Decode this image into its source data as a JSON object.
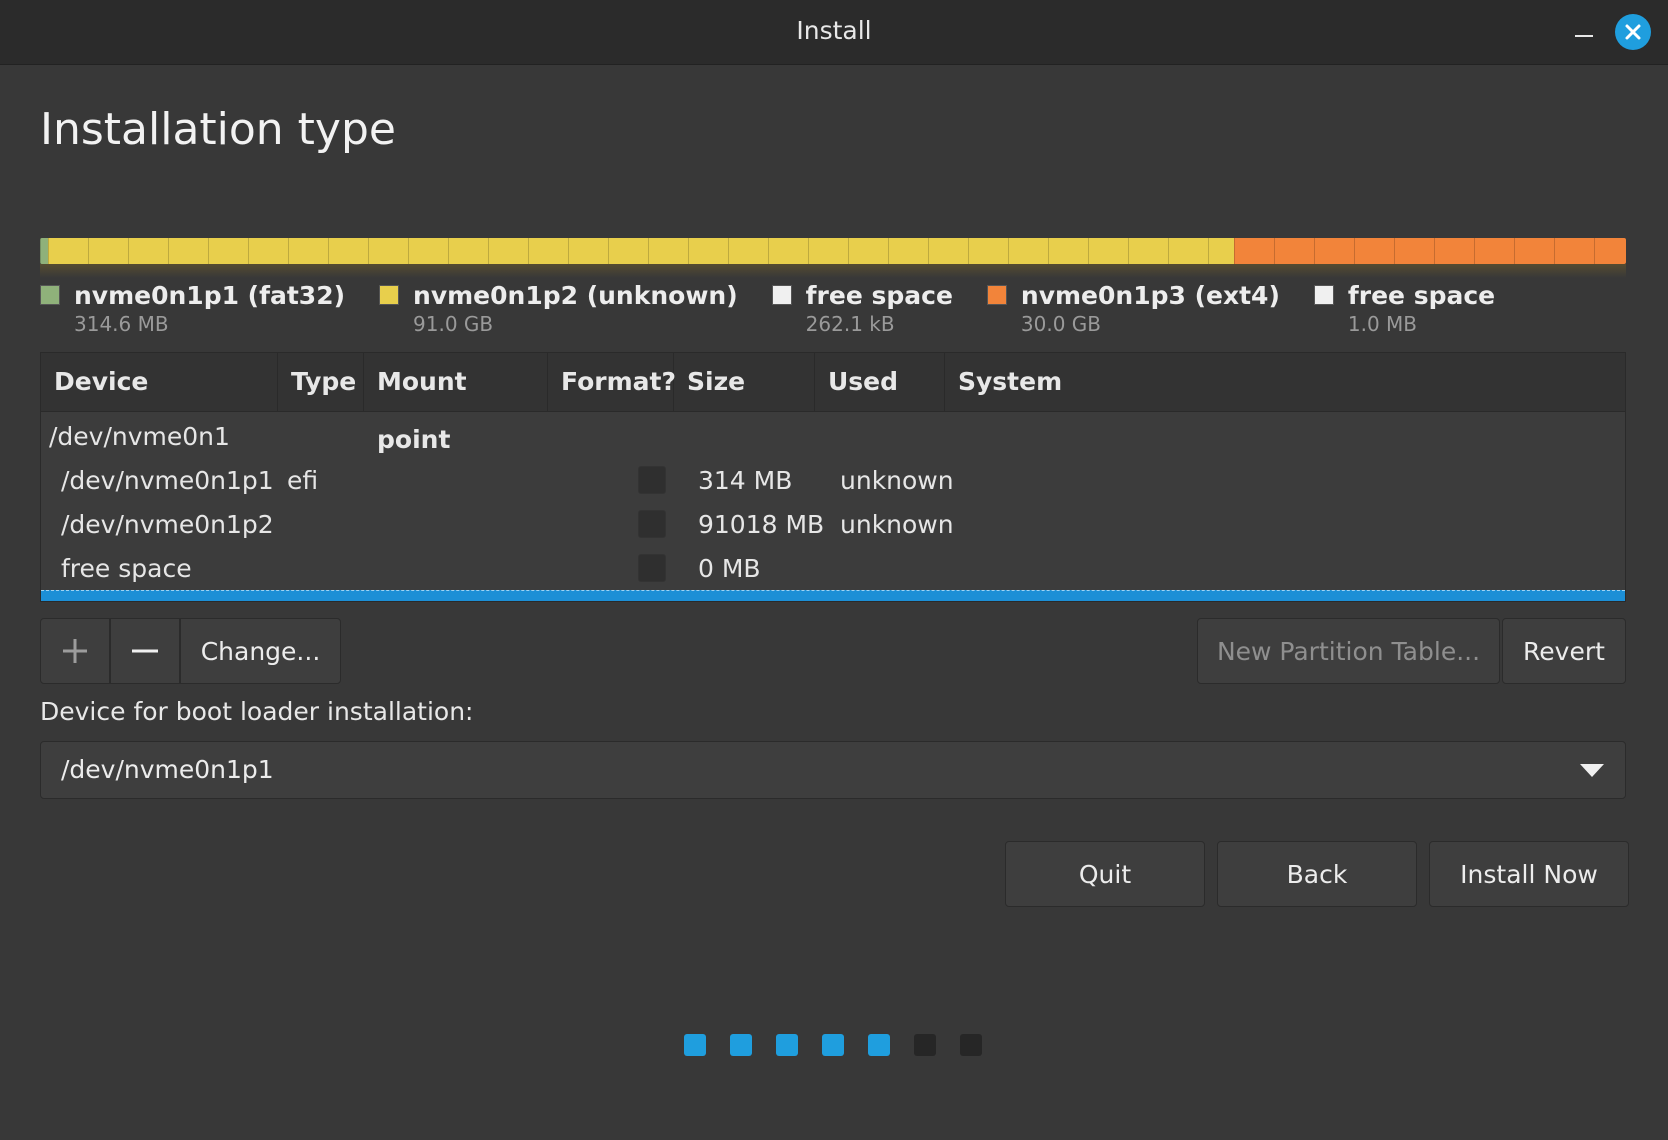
{
  "window": {
    "title": "Install"
  },
  "page": {
    "title": "Installation type"
  },
  "colors": {
    "fat32": "#8fb17a",
    "unknown": "#e8cf4c",
    "free": "#f0f0f0",
    "ext4": "#f2843a",
    "accent": "#1f9ede"
  },
  "partition_bar": [
    {
      "name": "nvme0n1p1 (fat32)",
      "size": "314.6 MB",
      "color": "#8fb17a"
    },
    {
      "name": "nvme0n1p2 (unknown)",
      "size": "91.0 GB",
      "color": "#e8cf4c"
    },
    {
      "name": "free space",
      "size": "262.1 kB",
      "color": "#f0f0f0"
    },
    {
      "name": "nvme0n1p3 (ext4)",
      "size": "30.0 GB",
      "color": "#f2843a"
    },
    {
      "name": "free space",
      "size": "1.0 MB",
      "color": "#f0f0f0"
    }
  ],
  "table": {
    "headers": [
      "Device",
      "Type",
      "Mount point",
      "Format?",
      "Size",
      "Used",
      "System"
    ],
    "rows": [
      {
        "device": "/dev/nvme0n1",
        "type": "",
        "mount": "",
        "format": null,
        "size": "",
        "used": "",
        "system": ""
      },
      {
        "device": "/dev/nvme0n1p1",
        "type": "efi",
        "mount": "",
        "format": false,
        "size": "314 MB",
        "used": "unknown",
        "system": ""
      },
      {
        "device": "/dev/nvme0n1p2",
        "type": "",
        "mount": "",
        "format": false,
        "size": "91018 MB",
        "used": "unknown",
        "system": ""
      },
      {
        "device": "free space",
        "type": "",
        "mount": "",
        "format": false,
        "size": "0 MB",
        "used": "",
        "system": ""
      }
    ]
  },
  "toolbar": {
    "add_icon": "plus-icon",
    "remove_icon": "minus-icon",
    "change_label": "Change...",
    "new_partition_table_label": "New Partition Table...",
    "revert_label": "Revert"
  },
  "bootloader": {
    "label": "Device for boot loader installation:",
    "selected": "/dev/nvme0n1p1"
  },
  "nav": {
    "quit_label": "Quit",
    "back_label": "Back",
    "install_label": "Install Now"
  },
  "progress": {
    "total_steps": 7,
    "completed_steps": 5
  }
}
